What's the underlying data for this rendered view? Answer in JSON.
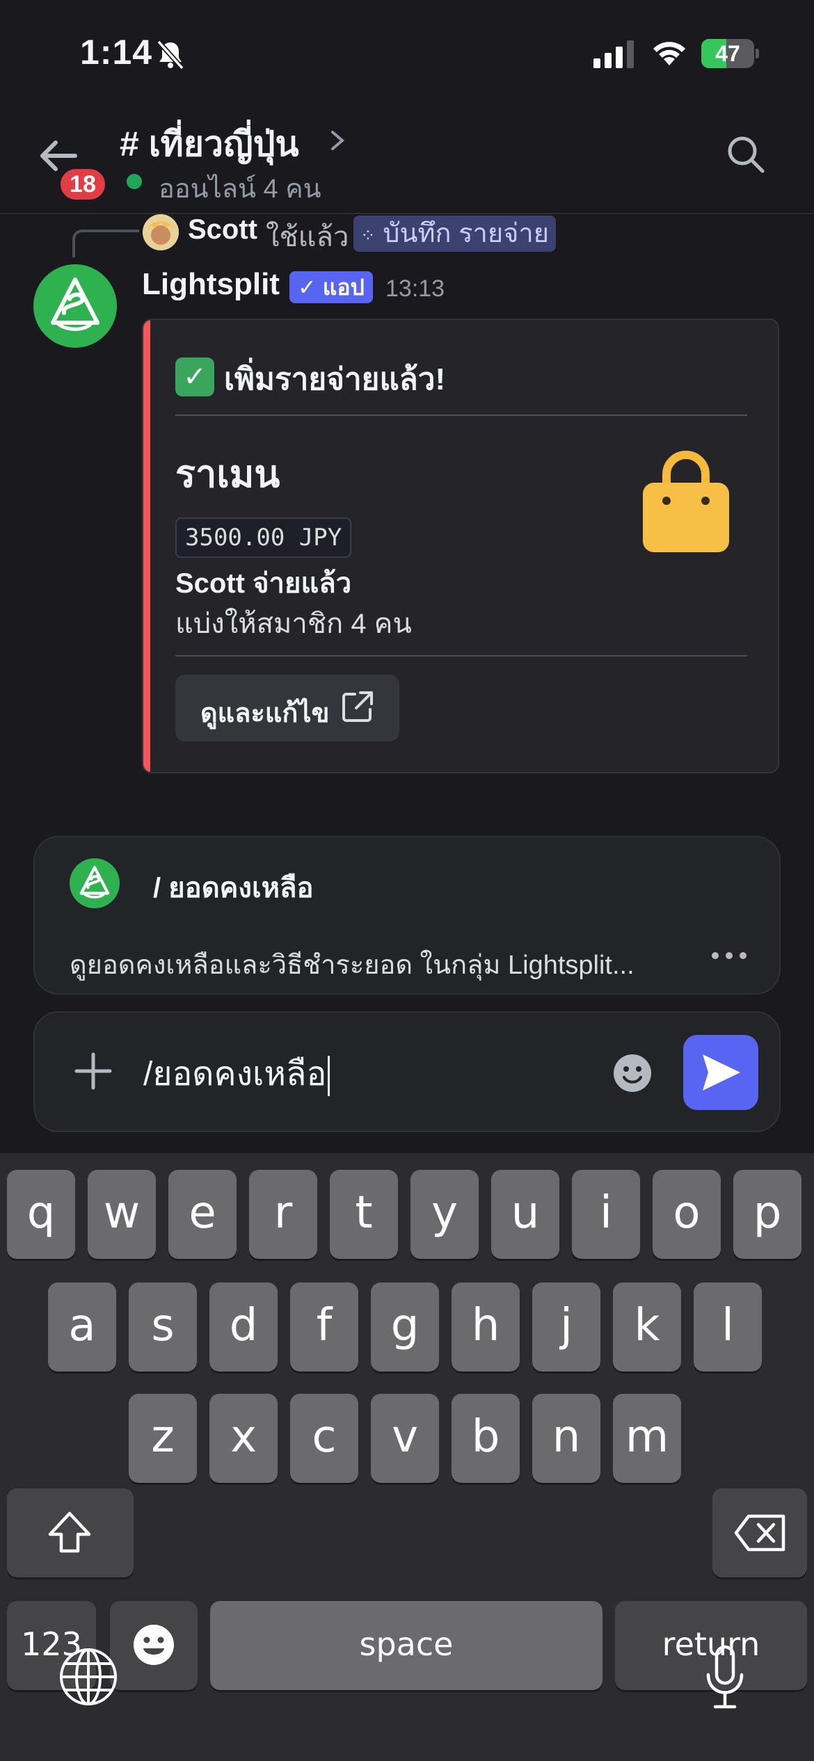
{
  "status_bar": {
    "time": "1:14",
    "battery_percent": "47",
    "battery_level": 0.47
  },
  "header": {
    "unread_badge": "18",
    "channel_title": "# เที่ยวญี่ปุ่น",
    "online_status": "ออนไลน์ 4 คน"
  },
  "reply": {
    "user": "Scott",
    "used_text": "ใช้แล้ว",
    "command": "บันทึก รายจ่าย"
  },
  "message": {
    "author": "Lightsplit",
    "app_tag": "✓ แอป",
    "time": "13:13",
    "embed": {
      "title": "เพิ่มรายจ่ายแล้ว!",
      "check_icon": "✓",
      "item": "ราเมน",
      "amount": "3500.00 JPY",
      "paid_by": "Scott จ่ายแล้ว",
      "split": "แบ่งให้สมาชิก 4 คน",
      "button_label": "ดูและแก้ไข",
      "accent_color": "#f2585b"
    }
  },
  "command_suggestion": {
    "name": "/ ยอดคงเหลือ",
    "description": "ดูยอดคงเหลือและวิธีชำระยอด ในกลุ่ม Lightsplit..."
  },
  "composer": {
    "value": "/ยอดคงเหลือ"
  },
  "keyboard": {
    "row1": [
      "q",
      "w",
      "e",
      "r",
      "t",
      "y",
      "u",
      "i",
      "o",
      "p"
    ],
    "row2": [
      "a",
      "s",
      "d",
      "f",
      "g",
      "h",
      "j",
      "k",
      "l"
    ],
    "row3": [
      "z",
      "x",
      "c",
      "v",
      "b",
      "n",
      "m"
    ],
    "numbers_key": "123",
    "space_key": "space",
    "return_key": "return"
  },
  "colors": {
    "background": "#1a1a1e",
    "accent": "#5865f2",
    "online": "#23a55a",
    "badge": "#e23c45",
    "bot_avatar": "#2eb24f"
  }
}
